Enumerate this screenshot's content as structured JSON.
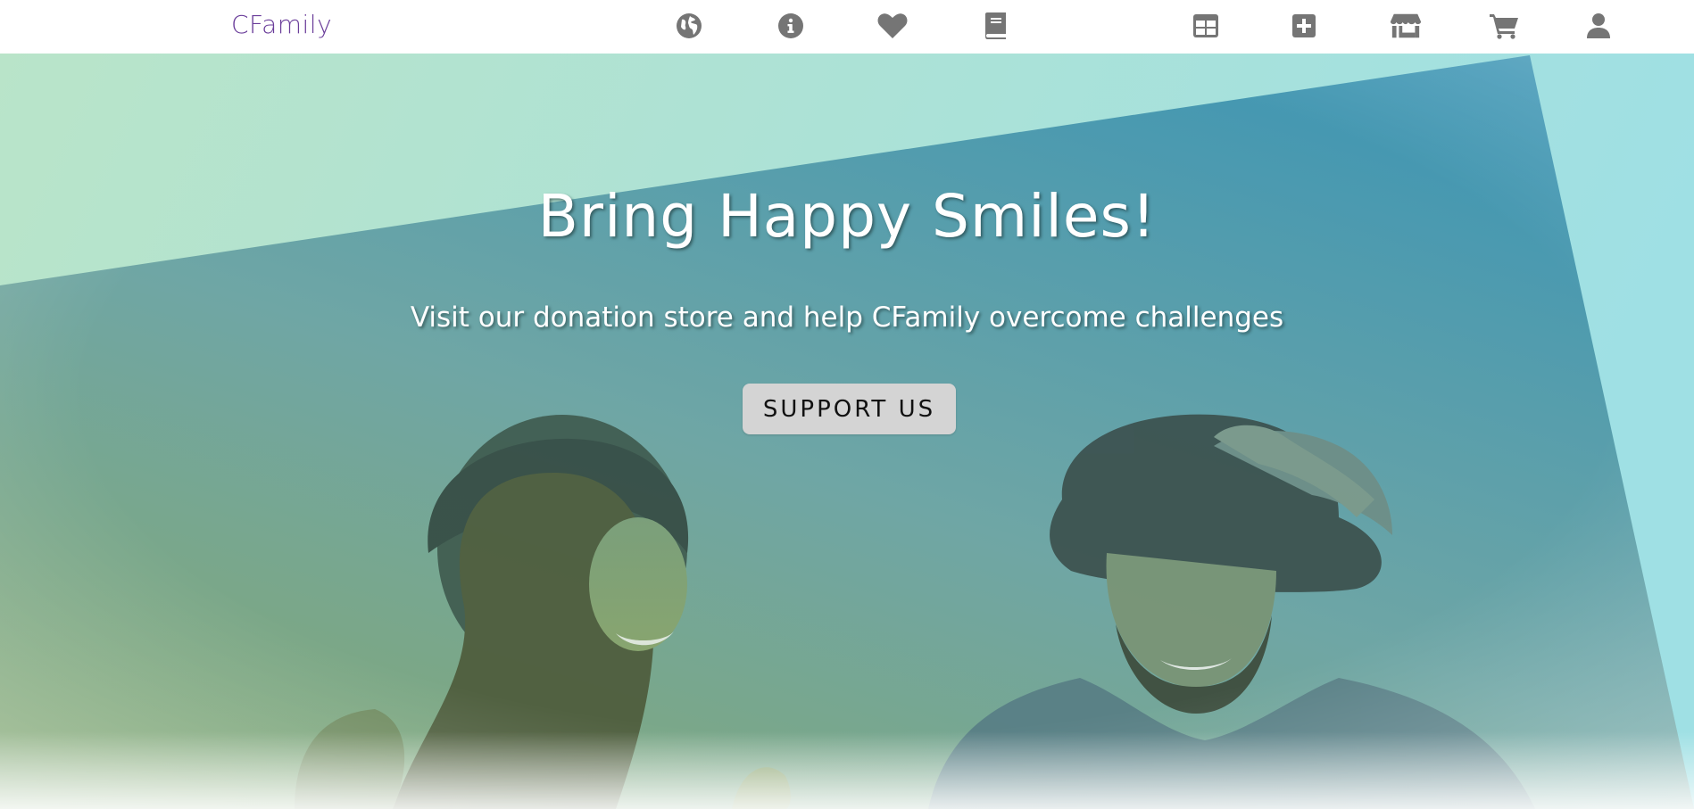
{
  "navbar": {
    "brand": "CFamily",
    "brand_color": "#6a3d9a",
    "icon_color": "#757575",
    "left_icons": [
      {
        "name": "globe-icon",
        "label": "Explore"
      },
      {
        "name": "info-icon",
        "label": "About"
      },
      {
        "name": "heart-icon",
        "label": "Favorites"
      },
      {
        "name": "book-icon",
        "label": "Stories"
      }
    ],
    "right_icons": [
      {
        "name": "table-icon",
        "label": "Dashboard"
      },
      {
        "name": "plus-square-icon",
        "label": "Add"
      },
      {
        "name": "store-icon",
        "label": "Store"
      },
      {
        "name": "cart-icon",
        "label": "Cart"
      },
      {
        "name": "user-icon",
        "label": "Account"
      }
    ]
  },
  "hero": {
    "title": "Bring Happy Smiles!",
    "subtitle": "Visit our donation store and help CFamily overcome challenges",
    "button_label": "SUPPORT US",
    "colors": {
      "gradient_start": "#b9e4c9",
      "gradient_end": "#9fe0e4",
      "overlay_start": "#7fa87a",
      "overlay_end": "#3e97b5",
      "text": "#ffffff",
      "button_bg": "#d4d4d4"
    },
    "image": "photo-couple-in-hats-smiling"
  }
}
